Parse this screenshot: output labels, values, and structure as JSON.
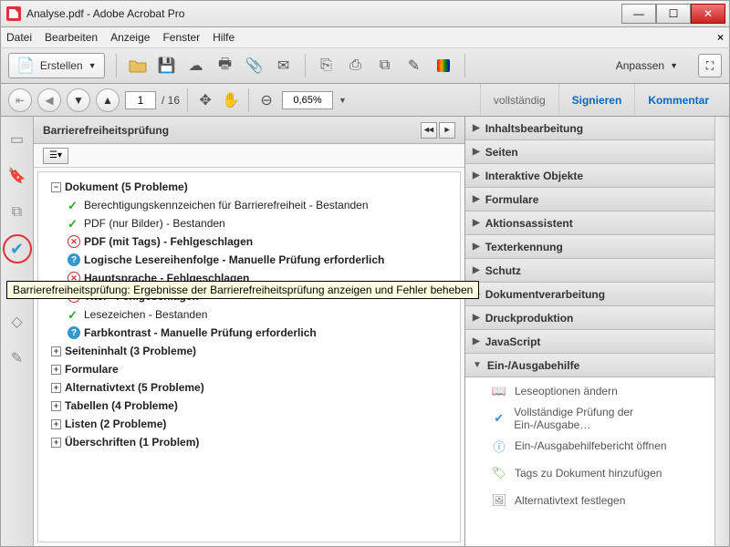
{
  "titlebar": {
    "text": "Analyse.pdf - Adobe Acrobat Pro"
  },
  "menubar": {
    "items": [
      "Datei",
      "Bearbeiten",
      "Anzeige",
      "Fenster",
      "Hilfe"
    ]
  },
  "toolbar1": {
    "create": "Erstellen",
    "anpassen": "Anpassen"
  },
  "toolbar2": {
    "page": "1",
    "pages": "/ 16",
    "zoom": "0,65%",
    "tabs": {
      "vollstaendig": "vollständig",
      "signieren": "Signieren",
      "kommentar": "Kommentar"
    }
  },
  "accpanel": {
    "title": "Barrierefreiheitsprüfung",
    "tooltip": "Barrierefreiheitsprüfung: Ergebnisse der Barrierefreiheitsprüfung anzeigen und Fehler beheben",
    "doc_header": "Dokument (5 Probleme)",
    "items": [
      {
        "status": "pass",
        "label": "Berechtigungskennzeichen für Barrierefreiheit - Bestanden"
      },
      {
        "status": "pass",
        "label": "PDF (nur Bilder) - Bestanden"
      },
      {
        "status": "fail",
        "label": "PDF (mit Tags) - Fehlgeschlagen",
        "bold": true
      },
      {
        "status": "info",
        "label": "Logische Lesereihenfolge  - Manuelle Prüfung erforderlich",
        "bold": true
      },
      {
        "status": "fail",
        "label": "Hauptsprache - Fehlgeschlagen",
        "bold": true
      },
      {
        "status": "fail",
        "label": "Titel - Fehlgeschlagen",
        "bold": true
      },
      {
        "status": "pass",
        "label": "Lesezeichen - Bestanden"
      },
      {
        "status": "info",
        "label": "Farbkontrast - Manuelle Prüfung erforderlich",
        "bold": true
      }
    ],
    "groups": [
      "Seiteninhalt (3 Probleme)",
      "Formulare",
      "Alternativtext (5 Probleme)",
      "Tabellen (4 Probleme)",
      "Listen (2 Probleme)",
      "Überschriften (1 Problem)"
    ]
  },
  "rpanel": {
    "sections": [
      "Inhaltsbearbeitung",
      "Seiten",
      "Interaktive Objekte",
      "Formulare",
      "Aktionsassistent",
      "Texterkennung",
      "Schutz",
      "Dokumentverarbeitung",
      "Druckproduktion",
      "JavaScript"
    ],
    "open_section": "Ein-/Ausgabehilfe",
    "open_items": [
      "Leseoptionen ändern",
      "Vollständige Prüfung der Ein-/Ausgabe…",
      "Ein-/Ausgabehilfebericht öffnen",
      "Tags zu Dokument hinzufügen",
      "Alternativtext festlegen"
    ]
  }
}
